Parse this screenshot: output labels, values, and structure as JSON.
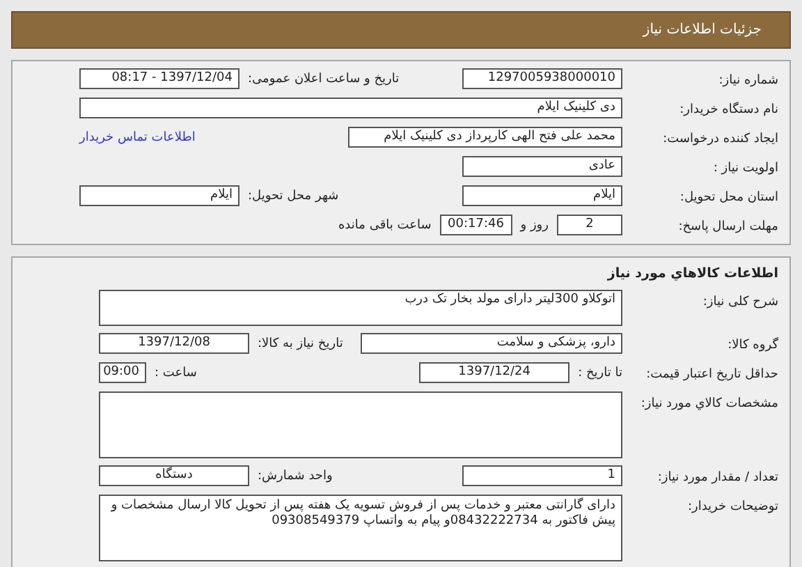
{
  "header": {
    "title": "جزئیات اطلاعات نیاز"
  },
  "need_panel": {
    "rows": [
      {
        "label": "شماره نیاز:",
        "items": [
          {
            "kind": "field",
            "value": "1297005938000010"
          },
          {
            "kind": "text",
            "value": "تاریخ و ساعت اعلان عمومی:"
          },
          {
            "kind": "field",
            "value": "1397/12/04 - 08:17"
          }
        ]
      },
      {
        "label": "نام دستگاه خریدار:",
        "items": [
          {
            "kind": "long-field",
            "value": "دی کلینیک ایلام"
          }
        ]
      },
      {
        "label": "ایجاد کننده درخواست:",
        "items": [
          {
            "kind": "long-field",
            "value": "محمد علی  فتح الهی کارپرداز دی کلینیک ایلام"
          },
          {
            "kind": "link",
            "value": "اطلاعات تماس خریدار"
          }
        ]
      },
      {
        "label": "اولویت نیاز :",
        "items": [
          {
            "kind": "field",
            "value": "عادی"
          }
        ]
      },
      {
        "label": "استان محل تحویل:",
        "items": [
          {
            "kind": "field",
            "value": "ایلام"
          },
          {
            "kind": "text",
            "value": "شهر محل تحویل:"
          },
          {
            "kind": "field",
            "value": "ایلام"
          }
        ]
      },
      {
        "label": "مهلت ارسال پاسخ:",
        "items": [
          {
            "kind": "day-field",
            "value": "2"
          },
          {
            "kind": "label",
            "value": "روز و"
          },
          {
            "kind": "clock-field",
            "value": "00:17:46"
          },
          {
            "kind": "label",
            "value": "ساعت باقی مانده"
          }
        ]
      }
    ]
  },
  "goods_panel": {
    "title": "اطلاعات كالاهاي مورد نياز",
    "rows": [
      {
        "label": "شرح کلی نیاز:",
        "items": [
          {
            "kind": "area",
            "value": "اتوکلاو 300لیتر دارای مولد بخار تک درب"
          }
        ]
      },
      {
        "label": "گروه کالا:",
        "items": [
          {
            "kind": "wide-field",
            "value": "دارو، پزشکی و سلامت"
          },
          {
            "kind": "text",
            "value": "تاریخ نیاز به کالا:"
          },
          {
            "kind": "date-field",
            "value": "1397/12/08"
          }
        ]
      },
      {
        "label": "حداقل تاریخ اعتبار قیمت:",
        "items": [
          {
            "kind": "label",
            "value": "تا تاریخ :"
          },
          {
            "kind": "date-field",
            "value": "1397/12/24"
          },
          {
            "kind": "text",
            "value": "ساعت :"
          },
          {
            "kind": "time-field",
            "value": "09:00"
          }
        ]
      },
      {
        "label": "مشخصات كالاي مورد نياز:",
        "items": [
          {
            "kind": "tall-area",
            "value": ""
          }
        ]
      },
      {
        "label": "تعداد / مقدار مورد نیاز:",
        "items": [
          {
            "kind": "field",
            "value": "1"
          },
          {
            "kind": "text",
            "value": "واحد شمارش:"
          },
          {
            "kind": "date-field",
            "value": "دستگاه"
          }
        ]
      },
      {
        "label": "توضیحات خریدار:",
        "items": [
          {
            "kind": "tall-area",
            "value": "دارای گارانتی معتبر و خدمات پس از فروش  تسویه یک هفته پس از تحویل کالا ارسال مشخصات و پیش فاکتور به 08432222734و پیام  به واتساپ 09308549379"
          }
        ]
      }
    ]
  }
}
